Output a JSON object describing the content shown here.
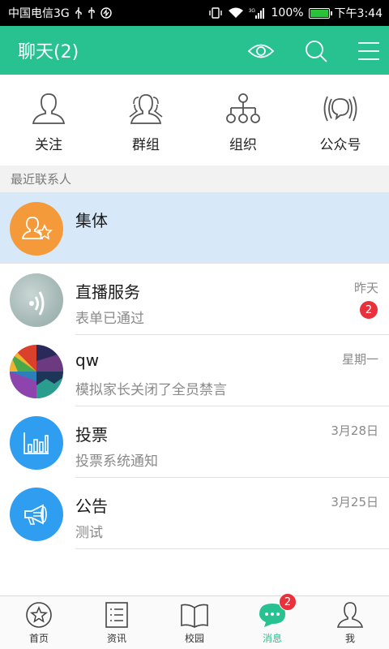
{
  "status_bar": {
    "carrier": "中国电信3G",
    "signal_type": "3G",
    "battery": "100%",
    "time": "下午3:44"
  },
  "header": {
    "title": "聊天(2)",
    "icons": [
      "eye-icon",
      "search-icon",
      "menu-icon"
    ]
  },
  "categories": [
    {
      "label": "关注",
      "icon": "person-icon"
    },
    {
      "label": "群组",
      "icon": "group-icon"
    },
    {
      "label": "组织",
      "icon": "org-chart-icon"
    },
    {
      "label": "公众号",
      "icon": "broadcast-icon"
    }
  ],
  "section_label": "最近联系人",
  "conversations": [
    {
      "name": "集体",
      "preview": "",
      "time": "",
      "badge": "",
      "avatar": "collective-icon",
      "avatar_color": "#f59a3b",
      "highlighted": true
    },
    {
      "name": "直播服务",
      "preview": "表单已通过",
      "time": "昨天",
      "badge": "2",
      "avatar": "live-service-icon",
      "avatar_color": "#9fb3b0",
      "highlighted": false
    },
    {
      "name": "qw",
      "preview": "模拟家长关闭了全员禁言",
      "time": "星期一",
      "badge": "",
      "avatar": "photo-collage-avatar",
      "avatar_color": "#7a5a9a",
      "highlighted": false
    },
    {
      "name": "投票",
      "preview": "投票系统通知",
      "time": "3月28日",
      "badge": "",
      "avatar": "bar-chart-icon",
      "avatar_color": "#2f9df0",
      "highlighted": false
    },
    {
      "name": "公告",
      "preview": "测试",
      "time": "3月25日",
      "badge": "",
      "avatar": "megaphone-icon",
      "avatar_color": "#2f9df0",
      "highlighted": false
    }
  ],
  "tabbar": [
    {
      "label": "首页",
      "icon": "star-circle-icon",
      "active": false,
      "badge": ""
    },
    {
      "label": "资讯",
      "icon": "news-list-icon",
      "active": false,
      "badge": ""
    },
    {
      "label": "校园",
      "icon": "book-icon",
      "active": false,
      "badge": ""
    },
    {
      "label": "消息",
      "icon": "chat-bubble-icon",
      "active": true,
      "badge": "2"
    },
    {
      "label": "我",
      "icon": "user-icon",
      "active": false,
      "badge": ""
    }
  ],
  "colors": {
    "primary": "#27c28f",
    "highlight_row": "#d7e8f8",
    "badge": "#e8313a"
  }
}
